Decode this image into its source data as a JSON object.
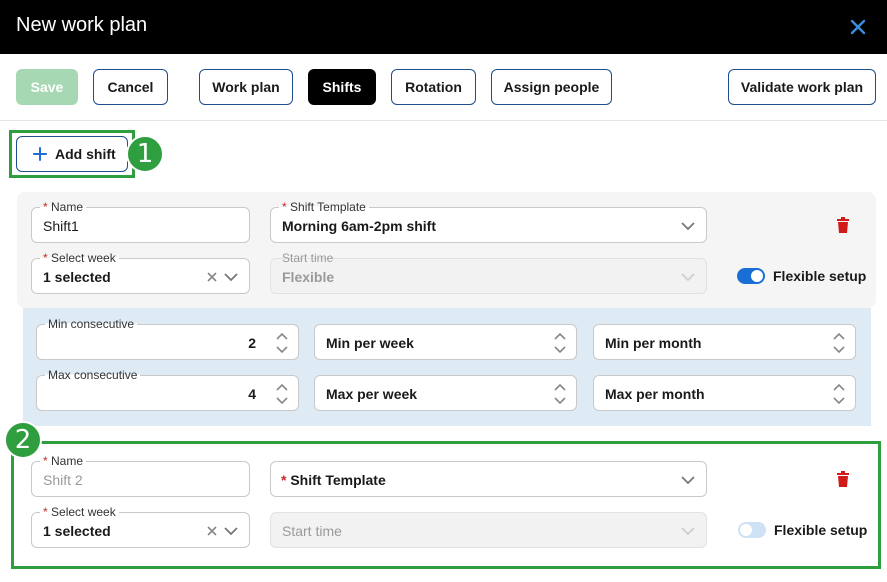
{
  "window": {
    "title": "New work plan",
    "close_icon": "close-icon"
  },
  "toolbar": {
    "save": "Save",
    "cancel": "Cancel",
    "tabs": [
      "Work plan",
      "Shifts",
      "Rotation",
      "Assign people"
    ],
    "active_tab": "Shifts",
    "validate": "Validate work plan"
  },
  "add_shift": {
    "label": "Add shift"
  },
  "callouts": [
    "1",
    "2"
  ],
  "shift1": {
    "name_label": "Name",
    "name_value": "Shift1",
    "template_label": "Shift Template",
    "template_value": "Morning 6am-2pm shift",
    "week_label": "Select week",
    "week_value": "1 selected",
    "start_label": "Start time",
    "start_value": "Flexible",
    "flexible_label": "Flexible setup",
    "flexible_on": true,
    "constraints": {
      "min_consecutive_label": "Min consecutive",
      "min_consecutive_value": "2",
      "max_consecutive_label": "Max consecutive",
      "max_consecutive_value": "4",
      "min_per_week": "Min per week",
      "min_per_month": "Min per month",
      "max_per_week": "Max per week",
      "max_per_month": "Max per month"
    }
  },
  "shift2": {
    "name_label": "Name",
    "name_placeholder": "Shift 2",
    "template_placeholder": "Shift Template",
    "week_label": "Select week",
    "week_value": "1 selected",
    "start_placeholder": "Start time",
    "flexible_label": "Flexible setup",
    "flexible_on": false
  },
  "colors": {
    "title_bg": "#000000",
    "accent_blue": "#1a6fd4",
    "callout_green": "#2e9e3e",
    "required_red": "#c62828",
    "save_disabled": "#a6d8b3"
  }
}
